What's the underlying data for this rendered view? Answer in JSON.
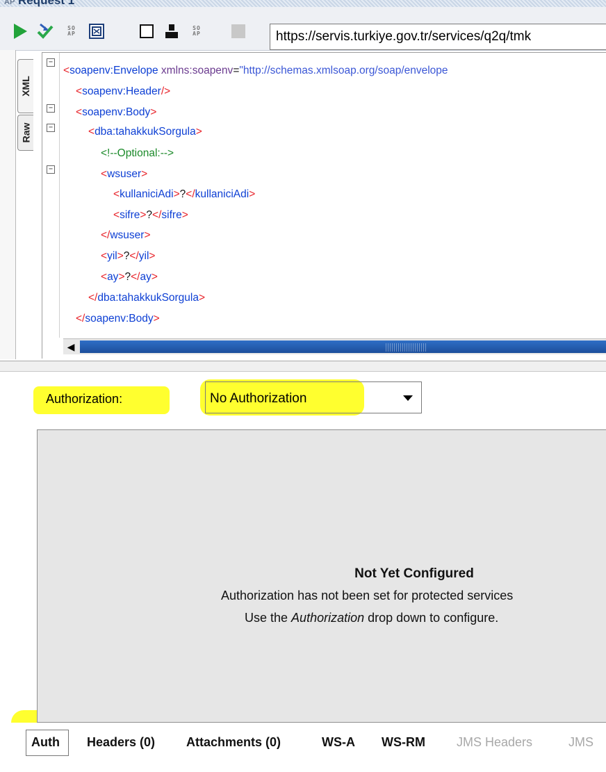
{
  "window": {
    "title": "Request 1",
    "app_badge": "AP"
  },
  "toolbar": {
    "buttons": [
      {
        "name": "submit-request",
        "icon": "play-icon"
      },
      {
        "name": "create-test-case",
        "icon": "check-arrow-icon"
      },
      {
        "name": "soap-action-1",
        "icon": "soap-icon",
        "text": "SO\nAP"
      },
      {
        "name": "validate",
        "icon": "frame-icon"
      },
      {
        "name": "maximize",
        "icon": "square-icon"
      },
      {
        "name": "user",
        "icon": "user-icon"
      },
      {
        "name": "soap-action-2",
        "icon": "soap-icon",
        "text": "SO\nAP"
      },
      {
        "name": "stop",
        "icon": "stop-icon"
      }
    ],
    "endpoint_url": "https://servis.turkiye.gov.tr/services/q2q/tmk"
  },
  "editor_tabs": {
    "xml": "XML",
    "raw": "Raw"
  },
  "xml_lines": [
    {
      "open": "<",
      "name": "soapenv:Envelope",
      "attr": " xmlns:soapenv",
      "eq": "=",
      "str": "\"http://schemas.xmlsoap.org/soap/envelope"
    },
    {
      "open": "<",
      "name": "soapenv:Header",
      "close": "/>"
    },
    {
      "open": "<",
      "name": "soapenv:Body",
      "close": ">"
    },
    {
      "open": "<",
      "name": "dba:tahakkukSorgula",
      "close": ">"
    },
    {
      "comment": "<!--Optional:-->"
    },
    {
      "open": "<",
      "name": "wsuser",
      "close": ">"
    },
    {
      "open": "<",
      "name": "kullaniciAdi",
      "close": ">",
      "text": "?",
      "end_open": "</",
      "end_name": "kullaniciAdi",
      "end_close": ">"
    },
    {
      "open": "<",
      "name": "sifre",
      "close": ">",
      "text": "?",
      "end_open": "</",
      "end_name": "sifre",
      "end_close": ">"
    },
    {
      "open": "</",
      "name": "wsuser",
      "close": ">"
    },
    {
      "open": "<",
      "name": "yil",
      "close": ">",
      "text": "?",
      "end_open": "</",
      "end_name": "yil",
      "end_close": ">"
    },
    {
      "open": "<",
      "name": "ay",
      "close": ">",
      "text": "?",
      "end_open": "</",
      "end_name": "ay",
      "end_close": ">"
    },
    {
      "open": "</",
      "name": "dba:tahakkukSorgula",
      "close": ">"
    },
    {
      "open": "</",
      "name": "soapenv:Body",
      "close": ">"
    }
  ],
  "auth": {
    "label": "Authorization:",
    "selected": "No Authorization",
    "not_configured_title": "Not Yet Configured",
    "message_line1": "Authorization has not been set for protected services",
    "message_line2_prefix": "Use the ",
    "message_line2_em": "Authorization",
    "message_line2_suffix": " drop down to configure."
  },
  "bottom_tabs": [
    {
      "label": "Auth",
      "active": true,
      "enabled": true
    },
    {
      "label": "Headers (0)",
      "active": false,
      "enabled": true
    },
    {
      "label": "Attachments (0)",
      "active": false,
      "enabled": true
    },
    {
      "label": "WS-A",
      "active": false,
      "enabled": true
    },
    {
      "label": "WS-RM",
      "active": false,
      "enabled": true
    },
    {
      "label": "JMS Headers",
      "active": false,
      "enabled": false
    },
    {
      "label": "JMS",
      "active": false,
      "enabled": false
    }
  ],
  "colors": {
    "highlight": "#ffff24",
    "xml_tag": "#e8232a",
    "xml_element": "#0d3fd4",
    "xml_comment": "#1c8a2a",
    "scroll_thumb": "#1c4e9b"
  }
}
